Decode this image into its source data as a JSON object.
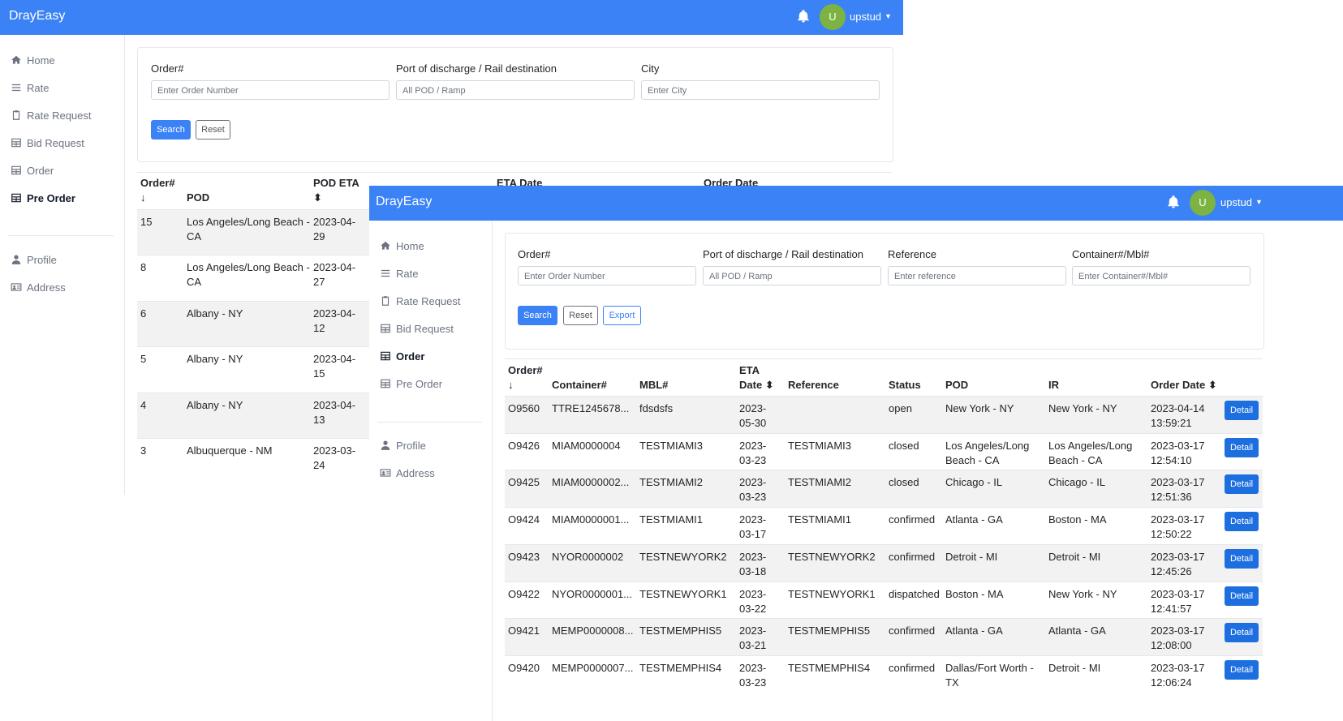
{
  "colors": {
    "primary": "#3b82f6",
    "avatar": "#7cb342",
    "detail_button": "#1d6fe0"
  },
  "back": {
    "brand": "DrayEasy",
    "avatar_letter": "U",
    "user": "upstud",
    "sidebar": [
      {
        "label": "Home",
        "icon": "home-icon"
      },
      {
        "label": "Rate",
        "icon": "list-icon"
      },
      {
        "label": "Rate Request",
        "icon": "clipboard-icon"
      },
      {
        "label": "Bid Request",
        "icon": "table-icon"
      },
      {
        "label": "Order",
        "icon": "table-icon"
      },
      {
        "label": "Pre Order",
        "icon": "table-icon",
        "active": true
      },
      {
        "label": "Profile",
        "icon": "user-icon"
      },
      {
        "label": "Address",
        "icon": "address-card-icon"
      }
    ],
    "filters": {
      "order": {
        "label": "Order#",
        "placeholder": "Enter Order Number"
      },
      "pod": {
        "label": "Port of discharge / Rail destination",
        "placeholder": "All POD / Ramp"
      },
      "city": {
        "label": "City",
        "placeholder": "Enter City"
      }
    },
    "buttons": {
      "search": "Search",
      "reset": "Reset"
    },
    "table": {
      "headers": {
        "order": "Order#",
        "order_sort": "↓",
        "pod": "POD",
        "pod_eta": "POD ETA",
        "pod_eta_sort": "⬍",
        "eta_date": "ETA Date",
        "order_date": "Order Date"
      },
      "rows": [
        {
          "order": "15",
          "pod": [
            "Los Angeles/Long Beach -",
            "CA"
          ],
          "eta": [
            "2023-04-",
            "29"
          ]
        },
        {
          "order": "8",
          "pod": [
            "Los Angeles/Long Beach -",
            "CA"
          ],
          "eta": [
            "2023-04-",
            "27"
          ]
        },
        {
          "order": "6",
          "pod": [
            "Albany - NY"
          ],
          "eta": [
            "2023-04-",
            "12"
          ]
        },
        {
          "order": "5",
          "pod": [
            "Albany - NY"
          ],
          "eta": [
            "2023-04-",
            "15"
          ]
        },
        {
          "order": "4",
          "pod": [
            "Albany - NY"
          ],
          "eta": [
            "2023-04-",
            "13"
          ]
        },
        {
          "order": "3",
          "pod": [
            "Albuquerque - NM"
          ],
          "eta": [
            "2023-03-",
            "24"
          ]
        }
      ]
    }
  },
  "front": {
    "brand": "DrayEasy",
    "avatar_letter": "U",
    "user": "upstud",
    "sidebar": [
      {
        "label": "Home",
        "icon": "home-icon"
      },
      {
        "label": "Rate",
        "icon": "list-icon"
      },
      {
        "label": "Rate Request",
        "icon": "clipboard-icon"
      },
      {
        "label": "Bid Request",
        "icon": "table-icon"
      },
      {
        "label": "Order",
        "icon": "table-icon",
        "active": true
      },
      {
        "label": "Pre Order",
        "icon": "table-icon"
      },
      {
        "label": "Profile",
        "icon": "user-icon"
      },
      {
        "label": "Address",
        "icon": "address-card-icon"
      }
    ],
    "filters": {
      "order": {
        "label": "Order#",
        "placeholder": "Enter Order Number"
      },
      "pod": {
        "label": "Port of discharge / Rail destination",
        "placeholder": "All POD / Ramp"
      },
      "reference": {
        "label": "Reference",
        "placeholder": "Enter reference"
      },
      "container": {
        "label": "Container#/Mbl#",
        "placeholder": "Enter Container#/Mbl#"
      }
    },
    "buttons": {
      "search": "Search",
      "reset": "Reset",
      "export": "Export",
      "detail": "Detail"
    },
    "table": {
      "headers": {
        "order": "Order#",
        "order_sort": "↓",
        "container": "Container#",
        "mbl": "MBL#",
        "eta": "ETA",
        "eta_date": "Date",
        "eta_sort": "⬍",
        "reference": "Reference",
        "status": "Status",
        "pod": "POD",
        "ir": "IR",
        "order_date": "Order Date",
        "order_date_sort": "⬍"
      },
      "rows": [
        {
          "order": "O9560",
          "container": "TTRE1245678...",
          "mbl": "fdsdsfs",
          "eta": [
            "2023-",
            "05-30"
          ],
          "reference": "",
          "status": "open",
          "pod": [
            "New York - NY"
          ],
          "ir": [
            "New York - NY"
          ],
          "date": [
            "2023-04-14",
            "13:59:21"
          ]
        },
        {
          "order": "O9426",
          "container": "MIAM0000004",
          "mbl": "TESTMIAMI3",
          "eta": [
            "2023-",
            "03-23"
          ],
          "reference": "TESTMIAMI3",
          "status": "closed",
          "pod": [
            "Los Angeles/Long",
            "Beach - CA"
          ],
          "ir": [
            "Los Angeles/Long",
            "Beach - CA"
          ],
          "date": [
            "2023-03-17",
            "12:54:10"
          ]
        },
        {
          "order": "O9425",
          "container": "MIAM0000002...",
          "mbl": "TESTMIAMI2",
          "eta": [
            "2023-",
            "03-23"
          ],
          "reference": "TESTMIAMI2",
          "status": "closed",
          "pod": [
            "Chicago - IL"
          ],
          "ir": [
            "Chicago - IL"
          ],
          "date": [
            "2023-03-17",
            "12:51:36"
          ]
        },
        {
          "order": "O9424",
          "container": "MIAM0000001...",
          "mbl": "TESTMIAMI1",
          "eta": [
            "2023-",
            "03-17"
          ],
          "reference": "TESTMIAMI1",
          "status": "confirmed",
          "pod": [
            "Atlanta - GA"
          ],
          "ir": [
            "Boston - MA"
          ],
          "date": [
            "2023-03-17",
            "12:50:22"
          ]
        },
        {
          "order": "O9423",
          "container": "NYOR0000002",
          "mbl": "TESTNEWYORK2",
          "eta": [
            "2023-",
            "03-18"
          ],
          "reference": "TESTNEWYORK2",
          "status": "confirmed",
          "pod": [
            "Detroit - MI"
          ],
          "ir": [
            "Detroit - MI"
          ],
          "date": [
            "2023-03-17",
            "12:45:26"
          ]
        },
        {
          "order": "O9422",
          "container": "NYOR0000001...",
          "mbl": "TESTNEWYORK1",
          "eta": [
            "2023-",
            "03-22"
          ],
          "reference": "TESTNEWYORK1",
          "status": "dispatched",
          "pod": [
            "Boston - MA"
          ],
          "ir": [
            "New York - NY"
          ],
          "date": [
            "2023-03-17",
            "12:41:57"
          ]
        },
        {
          "order": "O9421",
          "container": "MEMP0000008...",
          "mbl": "TESTMEMPHIS5",
          "eta": [
            "2023-",
            "03-21"
          ],
          "reference": "TESTMEMPHIS5",
          "status": "confirmed",
          "pod": [
            "Atlanta - GA"
          ],
          "ir": [
            "Atlanta - GA"
          ],
          "date": [
            "2023-03-17",
            "12:08:00"
          ]
        },
        {
          "order": "O9420",
          "container": "MEMP0000007...",
          "mbl": "TESTMEMPHIS4",
          "eta": [
            "2023-",
            "03-23"
          ],
          "reference": "TESTMEMPHIS4",
          "status": "confirmed",
          "pod": [
            "Dallas/Fort Worth -",
            "TX"
          ],
          "ir": [
            "Detroit - MI"
          ],
          "date": [
            "2023-03-17",
            "12:06:24"
          ]
        }
      ]
    }
  }
}
